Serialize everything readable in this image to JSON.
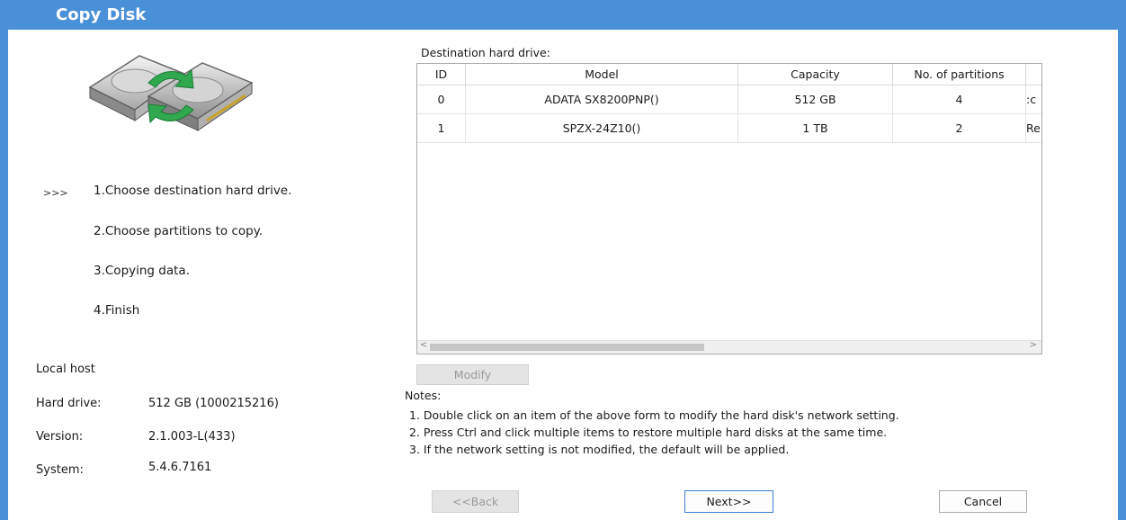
{
  "window": {
    "title": "Copy Disk"
  },
  "steps": [
    {
      "marker": ">>>",
      "label": "1.Choose destination hard drive.",
      "active": true
    },
    {
      "marker": "",
      "label": "2.Choose partitions to copy.",
      "active": false
    },
    {
      "marker": "",
      "label": "3.Copying data.",
      "active": false
    },
    {
      "marker": "",
      "label": "4.Finish",
      "active": false
    }
  ],
  "host": {
    "heading": "Local host",
    "hard_drive_label": "Hard drive:",
    "hard_drive_value": "512 GB (1000215216)",
    "version_label": "Version:",
    "version_value": "2.1.003-L(433)",
    "system_label": "System:",
    "system_value": "5.4.6.7161"
  },
  "destination": {
    "label": "Destination hard drive:",
    "columns": [
      "ID",
      "Model",
      "Capacity",
      "No. of partitions"
    ],
    "rows": [
      {
        "id": "0",
        "model": "ADATA SX8200PNP()",
        "capacity": "512 GB",
        "partitions": "4",
        "overflow": ":c"
      },
      {
        "id": "1",
        "model": "SPZX-24Z10()",
        "capacity": "1 TB",
        "partitions": "2",
        "overflow": "Re"
      }
    ]
  },
  "buttons": {
    "modify": "Modify",
    "back": "<<Back",
    "next": "Next>>",
    "cancel": "Cancel"
  },
  "notes": {
    "title": "Notes:",
    "items": [
      "1. Double click on an item of the above form to modify the hard disk's network setting.",
      "2. Press Ctrl and click multiple items to restore multiple hard disks at the same time.",
      "3. If the network setting is not modified, the default will be applied."
    ]
  },
  "colors": {
    "titlebar": "#4a90d9",
    "accent_arrow": "#2fa84f"
  },
  "icons": {
    "app_icon": "copy-disk-icon"
  }
}
